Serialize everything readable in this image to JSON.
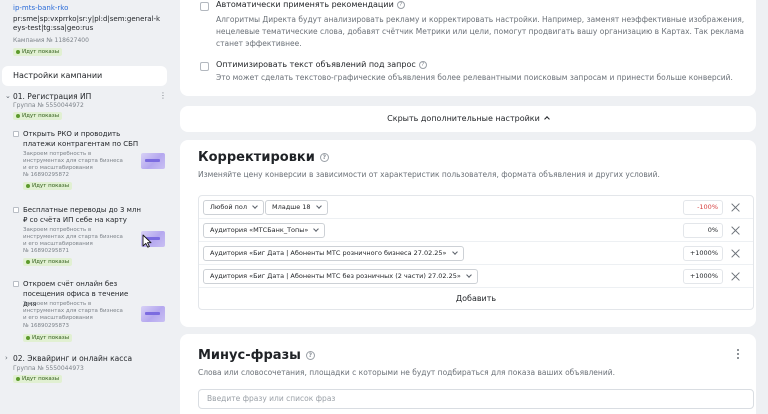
{
  "campaign": {
    "link": "ip-mts-bank-rko",
    "name": "pr:sme|sp:vxprrko|sr:y|pl:d|sem:general-keys-test|tg:ssa|geo:rus",
    "number": "Кампания № 118627400",
    "status": "Идут показы"
  },
  "sidebar": {
    "settings_label": "Настройки кампании",
    "groups": [
      {
        "toggle": "⌄",
        "name": "01. Регистрация ИП",
        "number": "Группа № 5550044972",
        "status": "Идут показы",
        "ads": [
          {
            "title": "Открыть РКО и проводить платежи контрагентам по СБП",
            "description": "Закроем потребность в инструментах для старта бизнеса и его масштабирования",
            "number": "№ 16890295872",
            "status": "Идут показы"
          },
          {
            "title": "Бесплатные переводы до 3 млн ₽ со счёта ИП себе на карту",
            "description": "Закроем потребность в инструментах для старта бизнеса и его масштабирования",
            "number": "№ 16890295871",
            "status": "Идут показы"
          },
          {
            "title": "Откроем счёт онлайн без посещения офиса в течение дня",
            "description": "Закроем потребность в инструментах для старта бизнеса и его масштабирования",
            "number": "№ 16890295873",
            "status": "Идут показы"
          }
        ]
      },
      {
        "toggle": "›",
        "name": "02. Эквайринг и онлайн касса",
        "number": "Группа № 5550044973",
        "status": "Идут показы"
      }
    ]
  },
  "options": [
    {
      "title": "Автоматически применять рекомендации",
      "description": "Алгоритмы Директа будут анализировать рекламу и корректировать настройки. Например, заменят неэффективные изображения, нецелевые тематические слова, добавят счётчик Метрики или цели, помогут продвигать вашу организацию в Картах. Так реклама станет эффективнее."
    },
    {
      "title": "Оптимизировать текст объявлений под запрос",
      "description": "Это может сделать текстово-графические объявления более релевантными поисковым запросам и принести больше конверсий."
    }
  ],
  "more_settings_label": "Скрыть дополнительные настройки",
  "adjustments": {
    "title": "Корректировки",
    "description": "Изменяйте цену конверсии в зависимости от характеристик пользователя, формата объявления и других условий.",
    "rows": [
      {
        "selects": [
          "Любой пол",
          "Младше 18"
        ],
        "value": "-100%"
      },
      {
        "selects": [
          "Аудитория «МТСБанк_Топы»"
        ],
        "value": "0%"
      },
      {
        "selects": [
          "Аудитория «Биг Дата | Абоненты МТС розничного бизнеса 27.02.25»"
        ],
        "value": "+1000%"
      },
      {
        "selects": [
          "Аудитория «Биг Дата | Абоненты МТС без розничных (2 части) 27.02.25»"
        ],
        "value": "+1000%"
      }
    ],
    "add_label": "Добавить"
  },
  "minus_phrases": {
    "title": "Минус-фразы",
    "description": "Слова или словосочетания, площадки с которыми не будут подбираться для показа ваших объявлений.",
    "placeholder": "Введите фразу или список фраз"
  }
}
